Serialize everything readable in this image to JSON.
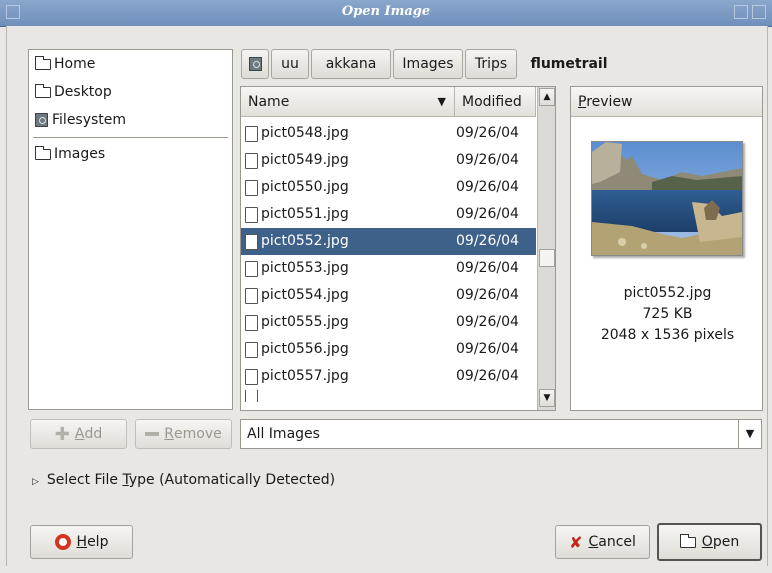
{
  "window": {
    "title": "Open Image"
  },
  "places": [
    {
      "label": "Home",
      "icon": "folder-icon"
    },
    {
      "label": "Desktop",
      "icon": "folder-icon"
    },
    {
      "label": "Filesystem",
      "icon": "drive-icon"
    }
  ],
  "bookmarks": [
    {
      "label": "Images",
      "icon": "folder-icon"
    }
  ],
  "path_buttons": [
    "uu",
    "akkana",
    "Images",
    "Trips",
    "flumetrail"
  ],
  "columns": {
    "name": "Name",
    "modified": "Modified"
  },
  "files": [
    {
      "name": "pict0548.jpg",
      "modified": "09/26/04"
    },
    {
      "name": "pict0549.jpg",
      "modified": "09/26/04"
    },
    {
      "name": "pict0550.jpg",
      "modified": "09/26/04"
    },
    {
      "name": "pict0551.jpg",
      "modified": "09/26/04"
    },
    {
      "name": "pict0552.jpg",
      "modified": "09/26/04"
    },
    {
      "name": "pict0553.jpg",
      "modified": "09/26/04"
    },
    {
      "name": "pict0554.jpg",
      "modified": "09/26/04"
    },
    {
      "name": "pict0555.jpg",
      "modified": "09/26/04"
    },
    {
      "name": "pict0556.jpg",
      "modified": "09/26/04"
    },
    {
      "name": "pict0557.jpg",
      "modified": "09/26/04"
    }
  ],
  "selected_index": 4,
  "preview": {
    "header_underline": "P",
    "header_rest": "review",
    "filename": "pict0552.jpg",
    "size": "725 KB",
    "dimensions": "2048 x 1536 pixels"
  },
  "buttons": {
    "add_underline": "A",
    "add_rest": "dd",
    "remove_underline": "R",
    "remove_rest": "emove",
    "help_underline": "H",
    "help_rest": "elp",
    "cancel_underline": "C",
    "cancel_rest": "ancel",
    "open_underline": "O",
    "open_rest": "pen"
  },
  "filter": {
    "value": "All Images"
  },
  "file_type": {
    "pre": "Select File ",
    "underline": "T",
    "post": "ype (Automatically Detected)"
  },
  "colors": {
    "selection": "#3e6189",
    "titlebar": "#7d9bc4",
    "cancel_icon": "#c1271b",
    "help_icon": "#d4341f"
  }
}
